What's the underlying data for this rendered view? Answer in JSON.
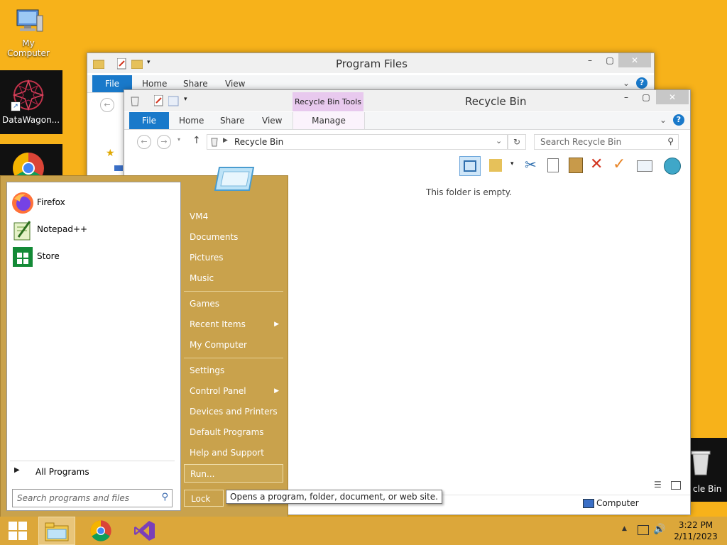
{
  "desktop": {
    "icons": [
      {
        "label": "My Computer"
      },
      {
        "label": "DataWagon..."
      },
      {
        "label": "cle Bin"
      }
    ]
  },
  "program_files_window": {
    "title": "Program Files",
    "tabs": [
      "File",
      "Home",
      "Share",
      "View"
    ]
  },
  "recycle_window": {
    "title": "Recycle Bin",
    "context_tab_group": "Recycle Bin Tools",
    "tabs": [
      "File",
      "Home",
      "Share",
      "View",
      "Manage"
    ],
    "address": "Recycle Bin",
    "search_placeholder": "Search Recycle Bin",
    "empty_message": "This folder is empty.",
    "status_location": "Computer"
  },
  "start_menu": {
    "programs": [
      {
        "label": "Firefox"
      },
      {
        "label": "Notepad++"
      },
      {
        "label": "Store"
      }
    ],
    "all_programs": "All Programs",
    "search_placeholder": "Search programs and files",
    "right_items": {
      "vm4": "VM4",
      "documents": "Documents",
      "pictures": "Pictures",
      "music": "Music",
      "games": "Games",
      "recent_items": "Recent Items",
      "my_computer": "My Computer",
      "settings": "Settings",
      "control_panel": "Control Panel",
      "devices_printers": "Devices and Printers",
      "default_programs": "Default Programs",
      "help_support": "Help and Support",
      "run": "Run..."
    },
    "lock": "Lock",
    "tooltip": "Opens a program, folder, document, or web site."
  },
  "taskbar": {
    "time": "3:22 PM",
    "date": "2/11/2023"
  },
  "colors": {
    "desktop_bg": "#f7b21a",
    "start_menu_bg": "#c9a24c",
    "accent_blue": "#1979ca",
    "context_tab": "#e8c9ee"
  }
}
